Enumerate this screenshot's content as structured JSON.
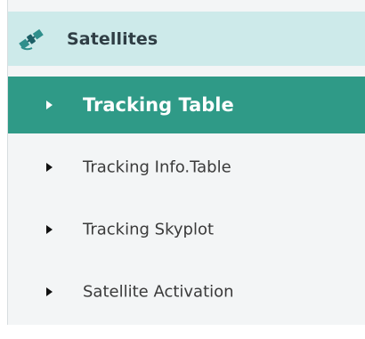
{
  "section": {
    "title": "Satellites",
    "icon": "satellite-icon"
  },
  "menu": {
    "items": [
      {
        "label": "Tracking Table",
        "active": true
      },
      {
        "label": "Tracking Info.Table",
        "active": false
      },
      {
        "label": "Tracking Skyplot",
        "active": false
      },
      {
        "label": "Satellite Activation",
        "active": false
      }
    ]
  },
  "colors": {
    "header_bg": "#cdeaea",
    "active_bg": "#2f9a87",
    "panel_bg": "#f3f5f6",
    "icon_accent": "#2f8f8c"
  }
}
